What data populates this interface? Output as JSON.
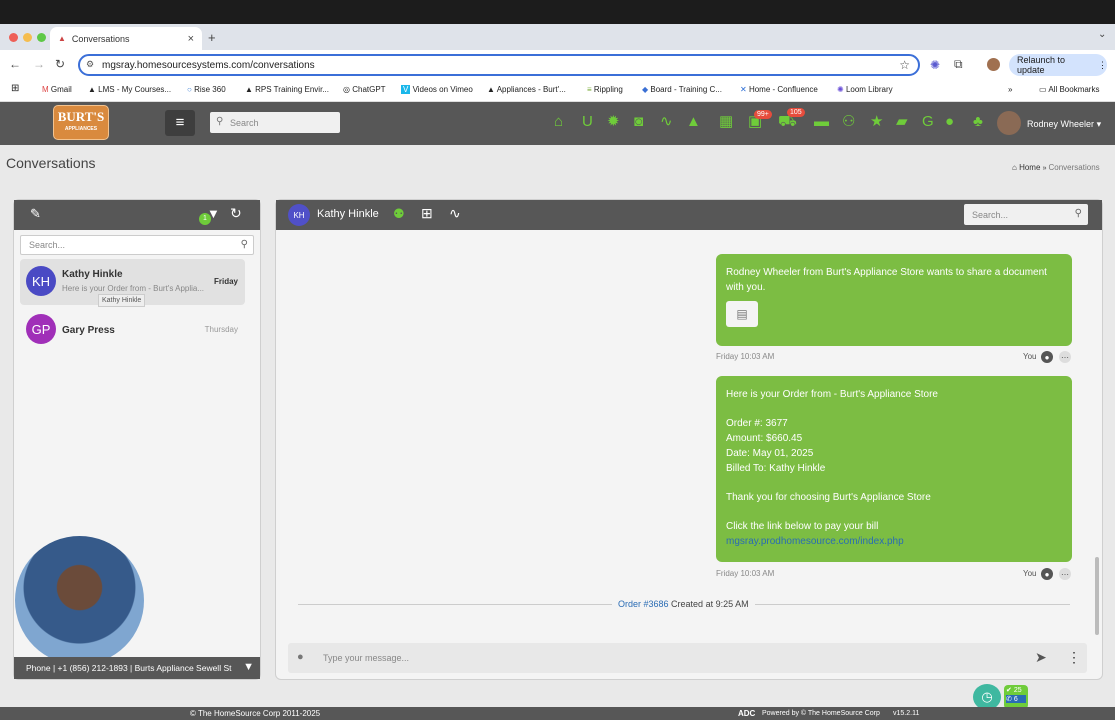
{
  "browser": {
    "tab_title": "Conversations",
    "url": "mgsray.homesourcesystems.com/conversations",
    "relaunch": "Relaunch to update",
    "bookmarks": [
      "Gmail",
      "LMS - My Courses...",
      "Rise 360",
      "RPS Training Envir...",
      "ChatGPT",
      "Videos on Vimeo",
      "Appliances - Burt'...",
      "Rippling",
      "Board - Training C...",
      "Home - Confluence",
      "Loom Library"
    ],
    "all_bookmarks": "All Bookmarks"
  },
  "header": {
    "logo": "BURT'S",
    "logo_sub": "APPLIANCES",
    "search_placeholder": "Search",
    "badge_1": "99+",
    "badge_2": "105",
    "user": "Rodney Wheeler"
  },
  "page": {
    "title": "Conversations",
    "crumb_home": "Home",
    "crumb_current": "Conversations"
  },
  "left": {
    "filter_count": "1",
    "search_placeholder": "Search...",
    "conversations": [
      {
        "initials": "KH",
        "name": "Kathy Hinkle",
        "preview": "Here is your Order from - Burt's Applia...",
        "date": "Friday",
        "color": "#4a4ac4"
      },
      {
        "initials": "GP",
        "name": "Gary Press",
        "preview": "",
        "date": "Thursday",
        "color": "#a02fb8"
      }
    ],
    "tooltip": "Kathy Hinkle",
    "phone": "Phone | +1 (856) 212-1893 | Burts Appliance Sewell St"
  },
  "chat": {
    "initials": "KH",
    "name": "Kathy Hinkle",
    "search_placeholder": "Search...",
    "messages": [
      {
        "text": "Rodney Wheeler from Burt's Appliance Store wants to share a document with you.",
        "time": "Friday 10:03 AM",
        "sender": "You"
      },
      {
        "lines": [
          "Here is your Order from - Burt's Appliance Store",
          "",
          "Order #: 3677",
          "Amount: $660.45",
          "Date: May 01, 2025",
          "Billed To: Kathy Hinkle",
          "",
          "Thank you for choosing Burt's Appliance Store",
          "",
          "Click the link below to pay your bill"
        ],
        "link": "mgsray.prodhomesource.com/index.php",
        "time": "Friday 10:03 AM",
        "sender": "You"
      }
    ],
    "order_link": "Order #3686",
    "order_text": " Created at 9:25 AM",
    "compose_placeholder": "Type your message..."
  },
  "widget": {
    "count_a": "25",
    "count_b": "6"
  },
  "footer": {
    "copyright": "© The HomeSource Corp 2011-2025",
    "adc": "ADC",
    "powered": "Powered by © The HomeSource Corp",
    "version": "v15.2.11"
  },
  "colors": {
    "accent_green": "#7cbd43",
    "header_gray": "#575757",
    "link": "#2a6cb4"
  }
}
